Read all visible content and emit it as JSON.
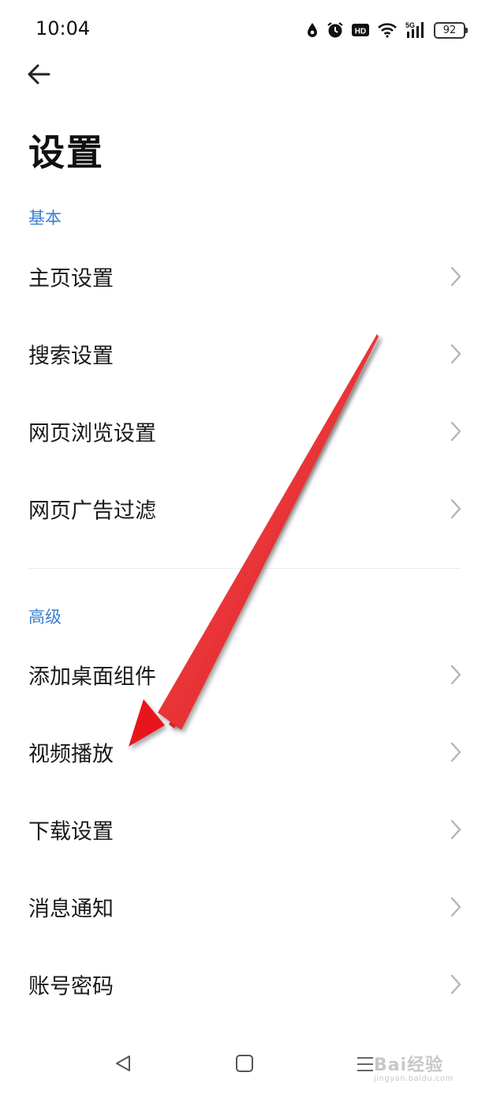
{
  "status_bar": {
    "time": "10:04",
    "network_label": "5G",
    "hd_label": "HD",
    "battery": "92",
    "icons": [
      "water-drop-icon",
      "alarm-icon",
      "hd-icon",
      "wifi-icon",
      "signal-5g-icon",
      "battery-icon"
    ]
  },
  "header": {
    "back_icon": "arrow-left-icon",
    "title": "设置"
  },
  "sections": [
    {
      "header": "基本",
      "items": [
        {
          "label": "主页设置"
        },
        {
          "label": "搜索设置"
        },
        {
          "label": "网页浏览设置"
        },
        {
          "label": "网页广告过滤"
        }
      ]
    },
    {
      "header": "高级",
      "items": [
        {
          "label": "添加桌面组件"
        },
        {
          "label": "视频播放"
        },
        {
          "label": "下载设置"
        },
        {
          "label": "消息通知"
        },
        {
          "label": "账号密码"
        }
      ]
    }
  ],
  "nav_bar": {
    "icons": [
      "triangle-back-icon",
      "square-home-icon",
      "menu-lines-icon"
    ]
  },
  "watermark": {
    "main": "Bai经验",
    "sub": "jingyan.baidu.com"
  },
  "colors": {
    "section_header": "#3a7fd0",
    "annotation_arrow": "#e8141c",
    "background": "#ffffff"
  }
}
